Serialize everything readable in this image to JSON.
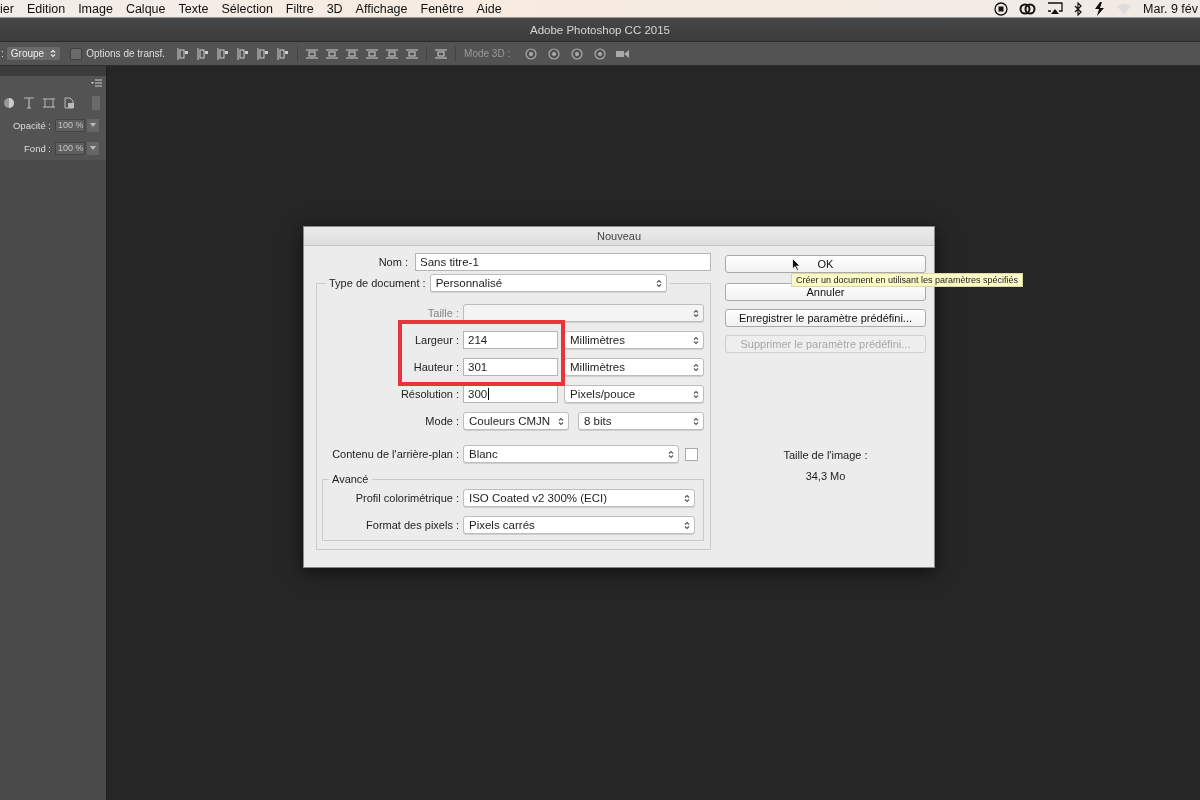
{
  "menu_bar": {
    "items": [
      "ier",
      "Edition",
      "Image",
      "Calque",
      "Texte",
      "Sélection",
      "Filtre",
      "3D",
      "Affichage",
      "Fenêtre",
      "Aide"
    ],
    "clock": "Mar. 9 fév"
  },
  "app_title": "Adobe Photoshop CC 2015",
  "options_bar": {
    "prefix": ":",
    "group_select": "Groupe",
    "transform_option": {
      "label": "Options de transf.",
      "checked": false
    },
    "mode_3d_label": "Mode 3D :"
  },
  "layers_panel": {
    "opacity": {
      "label": "Opacité :",
      "value": "100 %",
      "disabled": true
    },
    "fill": {
      "label": "Fond :",
      "value": "100 %",
      "disabled": true
    }
  },
  "dialog": {
    "title": "Nouveau",
    "name": {
      "label": "Nom :",
      "value": "Sans titre-1"
    },
    "document_type": {
      "label": "Type de document :",
      "value": "Personnalisé"
    },
    "size": {
      "label": "Taille :",
      "disabled": true
    },
    "width": {
      "label": "Largeur :",
      "value": "214",
      "unit": "Millimètres"
    },
    "height": {
      "label": "Hauteur :",
      "value": "301",
      "unit": "Millimètres"
    },
    "resolution": {
      "label": "Résolution :",
      "value": "300",
      "unit": "Pixels/pouce",
      "focused": true
    },
    "mode": {
      "label": "Mode :",
      "value": "Couleurs CMJN",
      "depth": "8 bits"
    },
    "background": {
      "label": "Contenu de l'arrière-plan :",
      "value": "Blanc"
    },
    "advanced": {
      "title": "Avancé",
      "color_profile": {
        "label": "Profil colorimétrique :",
        "value": "ISO Coated v2 300% (ECI)"
      },
      "pixel_format": {
        "label": "Format des pixels :",
        "value": "Pixels carrés"
      }
    },
    "buttons": [
      {
        "label": "OK",
        "disabled": false
      },
      {
        "label": "Annuler",
        "disabled": false
      },
      {
        "label": "Enregistrer le paramètre prédéfini...",
        "disabled": false
      },
      {
        "label": "Supprimer le paramètre prédéfini...",
        "disabled": true
      }
    ],
    "image_size": {
      "label": "Taille de l'image :",
      "value": "34,3 Mo"
    },
    "tooltip": "Créer un document en utilisant les paramètres spécifiés"
  }
}
